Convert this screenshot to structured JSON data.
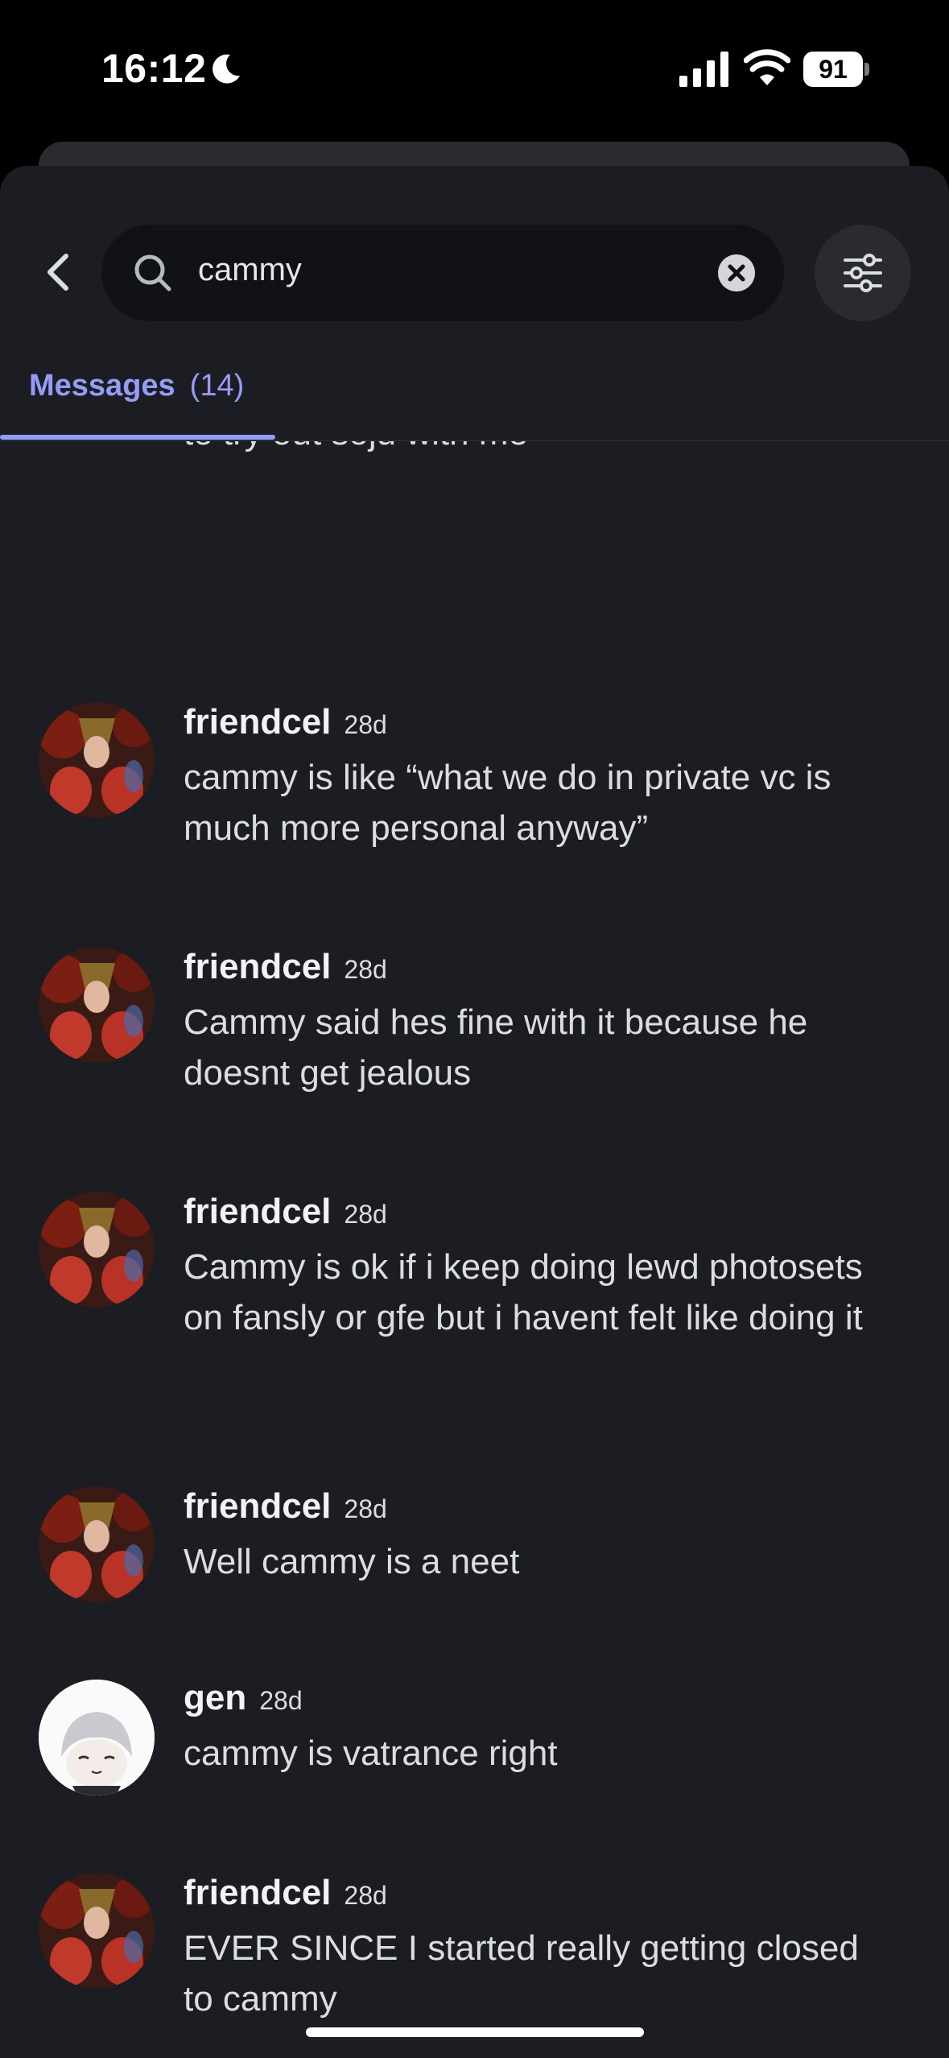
{
  "status_bar": {
    "time": "16:12",
    "battery_level": "91",
    "icons": [
      "moon-icon",
      "cellular-signal-icon",
      "wifi-icon",
      "battery-icon"
    ]
  },
  "search": {
    "query": "cammy",
    "icons": [
      "back-chevron-icon",
      "search-icon",
      "clear-icon",
      "filter-sliders-icon"
    ]
  },
  "tabs": [
    {
      "label": "Messages",
      "count": "(14)",
      "active": true
    }
  ],
  "partial_message": "to try out soju with me",
  "messages": [
    {
      "author": "friendcel",
      "time": "28d",
      "body": "cammy is like “what we do in private vc is much more personal anyway”",
      "avatar": "friendcel"
    },
    {
      "author": "friendcel",
      "time": "28d",
      "body": "Cammy said hes fine with it because he doesnt get jealous",
      "avatar": "friendcel"
    },
    {
      "author": "friendcel",
      "time": "28d",
      "body": "Cammy is ok if i keep doing lewd photosets on fansly or gfe but i havent felt like doing it",
      "avatar": "friendcel"
    },
    {
      "author": "friendcel",
      "time": "28d",
      "body": "Well cammy is a neet",
      "avatar": "friendcel"
    },
    {
      "author": "gen",
      "time": "28d",
      "body": "cammy is vatrance right",
      "avatar": "gen"
    },
    {
      "author": "friendcel",
      "time": "28d",
      "body": "EVER SINCE I started really getting closed to cammy",
      "avatar": "friendcel"
    }
  ],
  "colors": {
    "background": "#1c1d22",
    "accent": "#949cf7",
    "search_bg": "#111216"
  }
}
